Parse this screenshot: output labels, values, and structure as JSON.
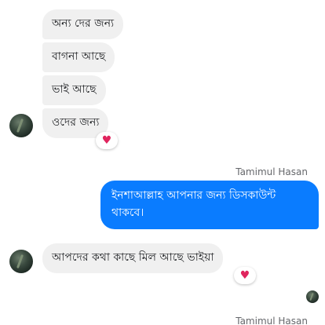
{
  "messages_in_group1": [
    "অন্য দের জন্য",
    "বাগনা আছে",
    "ভাই আছে",
    "ওদের জন্য"
  ],
  "reaction_emoji": "♥",
  "outgoing": {
    "sender": "Tamimul Hasan",
    "text": "ইনশাআল্লাহ আপনার জন্য ডিসকাউন্ট থাকবে।"
  },
  "messages_in_group2": [
    "আপদের কথা কাছে মিল আছে ভাইয়া"
  ],
  "trailing_sender": "Tamimul Hasan",
  "colors": {
    "incoming_bubble": "#f0f0f0",
    "outgoing_bubble": "#0a7cff",
    "heart": "#e0245e",
    "sender_name": "#65676b"
  }
}
